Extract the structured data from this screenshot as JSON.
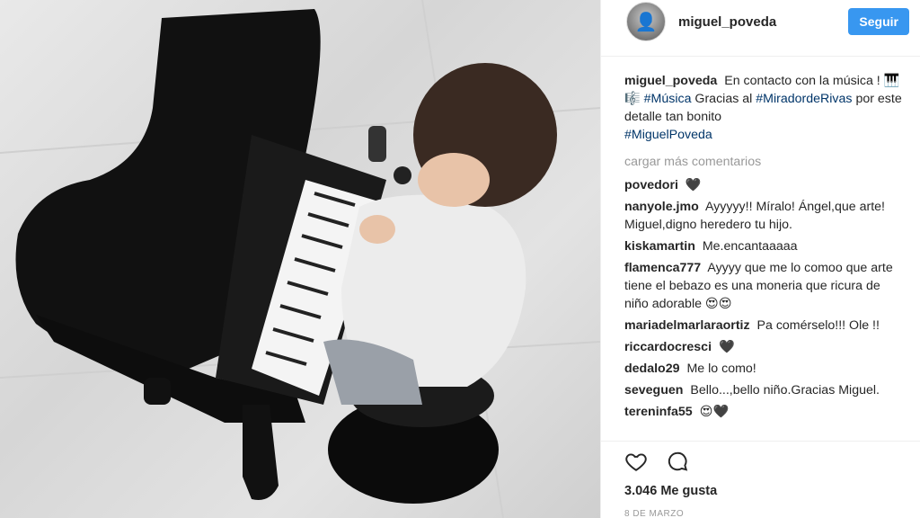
{
  "post": {
    "image_alt": "Child playing a toy grand piano",
    "author": "miguel_poveda",
    "follow_label": "Seguir"
  },
  "caption": {
    "user": "miguel_poveda",
    "text_1": "En contacto con la música !",
    "emoji": "🎹🎼",
    "hashtag_1": "#Música",
    "text_2": "Gracias al",
    "hashtag_2": "#MiradordeRivas",
    "text_3": "por este detalle tan bonito",
    "hashtag_3": "#MiguelPoveda"
  },
  "load_more": "cargar más comentarios",
  "comments": [
    {
      "user": "povedori",
      "text": "🖤"
    },
    {
      "user": "nanyole.jmo",
      "text": "Ayyyyy!! Míralo! Ángel,que arte! Miguel,digno heredero tu hijo."
    },
    {
      "user": "kiskamartin",
      "text": "Me.encantaaaaa"
    },
    {
      "user": "flamenca777",
      "text": "Ayyyy que me lo comoo que arte tiene el bebazo es una moneria que ricura de niño adorable 😍😍"
    },
    {
      "user": "mariadelmarlaraortiz",
      "text": "Pa comérselo!!! Ole !!"
    },
    {
      "user": "riccardocresci",
      "text": "🖤"
    },
    {
      "user": "dedalo29",
      "text": "Me lo como!"
    },
    {
      "user": "seveguen",
      "text": "Bello...,bello niño.Gracias Miguel."
    },
    {
      "user": "tereninfa55",
      "text": "😍🖤"
    }
  ],
  "actions": {
    "like_icon": "heart-icon",
    "comment_icon": "comment-icon"
  },
  "likes": "3.046 Me gusta",
  "date": "8 DE MARZO",
  "colors": {
    "accent": "#3897f0",
    "hashtag": "#003569",
    "muted": "#999999"
  }
}
